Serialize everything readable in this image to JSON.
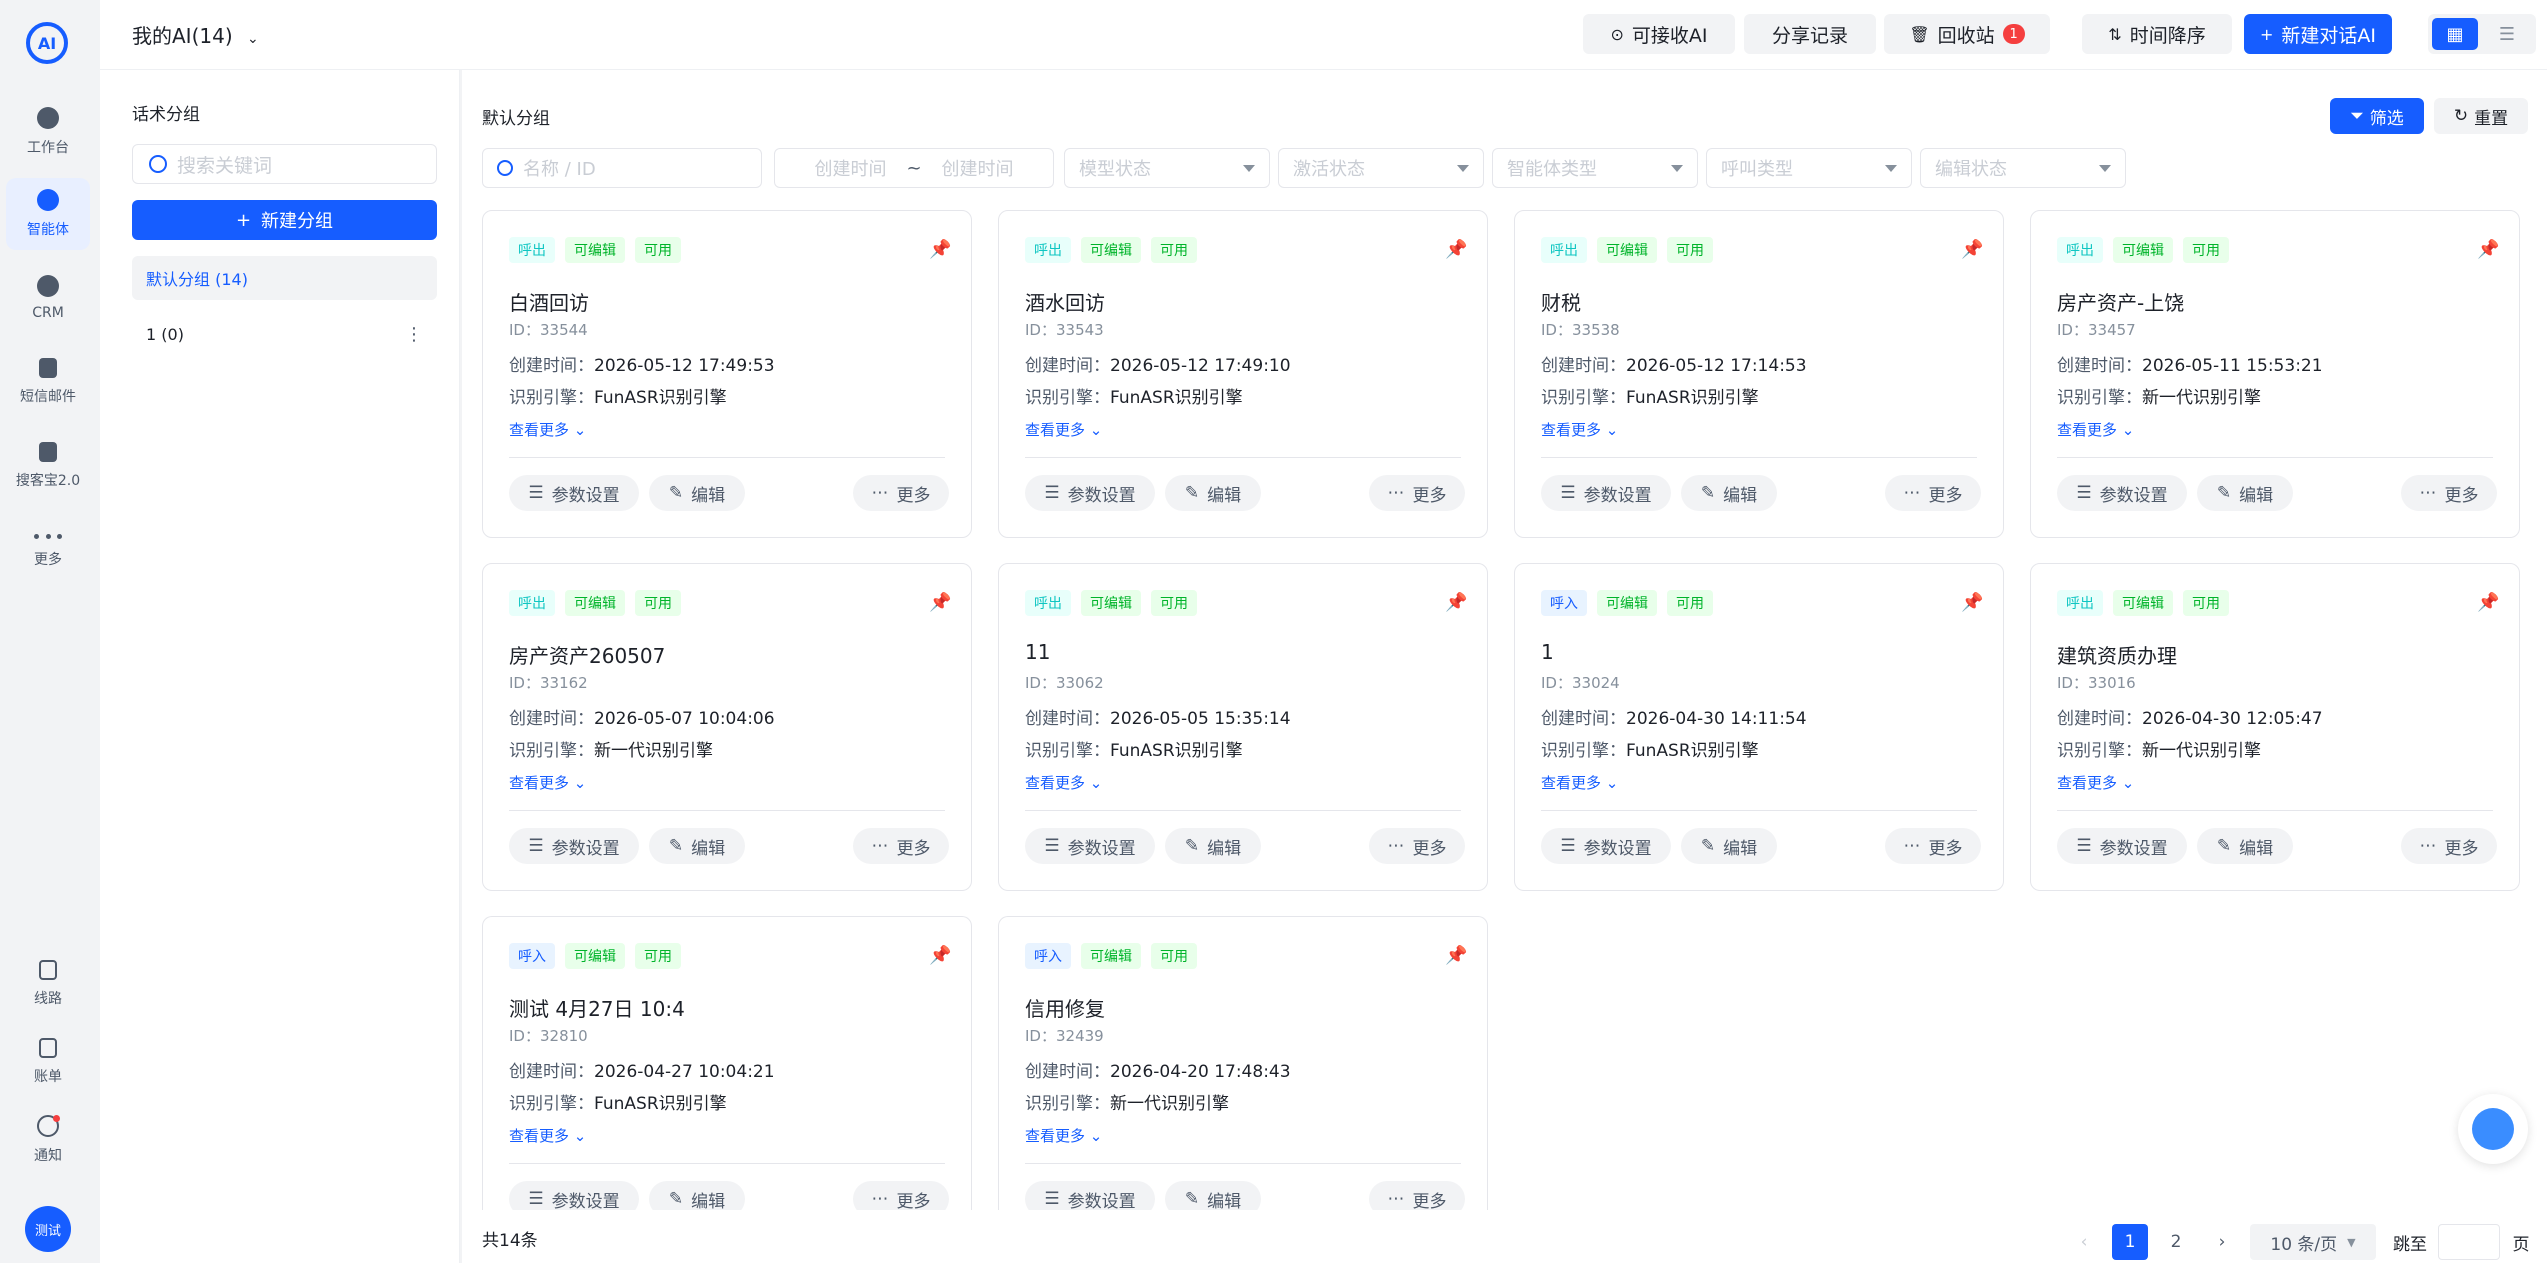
{
  "nav": {
    "items": [
      {
        "label": "工作台",
        "icon": "workbench-icon"
      },
      {
        "label": "智能体",
        "icon": "agent-icon",
        "active": true
      },
      {
        "label": "CRM",
        "icon": "crm-icon"
      },
      {
        "label": "短信邮件",
        "icon": "message-icon"
      },
      {
        "label": "搜客宝2.0",
        "icon": "search-customer-icon"
      },
      {
        "label": "更多",
        "icon": "more-dots-icon"
      }
    ],
    "bottom": [
      {
        "label": "线路",
        "icon": "route-icon"
      },
      {
        "label": "账单",
        "icon": "bill-icon"
      },
      {
        "label": "通知",
        "icon": "bell-icon"
      }
    ],
    "avatar": "测试"
  },
  "header": {
    "title": "我的AI(14)",
    "receivable": "可接收AI",
    "share": "分享记录",
    "recycle": "回收站",
    "recycle_count": "1",
    "sort": "时间降序",
    "new_ai": "新建对话AI"
  },
  "groups": {
    "title": "话术分组",
    "search_placeholder": "搜索关键词",
    "new_group": "新建分组",
    "items": [
      {
        "label": "默认分组 (14)"
      },
      {
        "label": "1 (0)"
      }
    ]
  },
  "main": {
    "title": "默认分组",
    "filter_btn": "筛选",
    "reset_btn": "重置",
    "filters": {
      "name_placeholder": "名称 / ID",
      "time_start": "创建时间",
      "time_sep": "~",
      "time_end": "创建时间",
      "model_status": "模型状态",
      "activation_status": "激活状态",
      "agent_type": "智能体类型",
      "call_type": "呼叫类型",
      "edit_status": "编辑状态"
    },
    "card_labels": {
      "id_prefix": "ID：",
      "created_prefix": "创建时间：",
      "engine_prefix": "识别引擎：",
      "see_more": "查看更多",
      "params": "参数设置",
      "edit": "编辑",
      "more": "更多"
    },
    "cards": [
      {
        "direction": "呼出",
        "editable": "可编辑",
        "status": "可用",
        "name": "白酒回访",
        "id": "33544",
        "created": "2026-05-12 17:49:53",
        "engine": "FunASR识别引擎"
      },
      {
        "direction": "呼出",
        "editable": "可编辑",
        "status": "可用",
        "name": "酒水回访",
        "id": "33543",
        "created": "2026-05-12 17:49:10",
        "engine": "FunASR识别引擎"
      },
      {
        "direction": "呼出",
        "editable": "可编辑",
        "status": "可用",
        "name": "财税",
        "id": "33538",
        "created": "2026-05-12 17:14:53",
        "engine": "FunASR识别引擎"
      },
      {
        "direction": "呼出",
        "editable": "可编辑",
        "status": "可用",
        "name": "房产资产-上饶",
        "id": "33457",
        "created": "2026-05-11 15:53:21",
        "engine": "新一代识别引擎"
      },
      {
        "direction": "呼出",
        "editable": "可编辑",
        "status": "可用",
        "name": "房产资产260507",
        "id": "33162",
        "created": "2026-05-07 10:04:06",
        "engine": "新一代识别引擎"
      },
      {
        "direction": "呼出",
        "editable": "可编辑",
        "status": "可用",
        "name": "11",
        "id": "33062",
        "created": "2026-05-05 15:35:14",
        "engine": "FunASR识别引擎"
      },
      {
        "direction": "呼入",
        "editable": "可编辑",
        "status": "可用",
        "name": "1",
        "id": "33024",
        "created": "2026-04-30 14:11:54",
        "engine": "FunASR识别引擎"
      },
      {
        "direction": "呼出",
        "editable": "可编辑",
        "status": "可用",
        "name": "建筑资质办理",
        "id": "33016",
        "created": "2026-04-30 12:05:47",
        "engine": "新一代识别引擎"
      },
      {
        "direction": "呼入",
        "editable": "可编辑",
        "status": "可用",
        "name": "测试 4月27日 10:4",
        "id": "32810",
        "created": "2026-04-27 10:04:21",
        "engine": "FunASR识别引擎"
      },
      {
        "direction": "呼入",
        "editable": "可编辑",
        "status": "可用",
        "name": "信用修复",
        "id": "32439",
        "created": "2026-04-20 17:48:43",
        "engine": "新一代识别引擎"
      }
    ]
  },
  "footer": {
    "total": "共14条",
    "pages": [
      "1",
      "2"
    ],
    "current_page": "1",
    "page_size": "10 条/页",
    "goto": "跳至",
    "page_unit": "页"
  },
  "colors": {
    "primary": "#165dff",
    "danger": "#f53f3f",
    "success": "#00b42a",
    "cyan": "#0fc6c2"
  }
}
